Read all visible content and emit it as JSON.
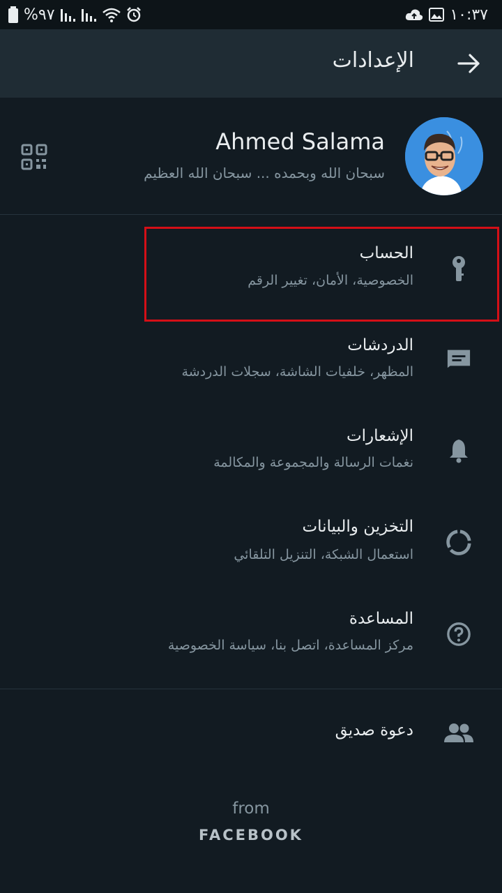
{
  "status_bar": {
    "battery": "%٩٧",
    "time": "١٠:٣٧"
  },
  "header": {
    "title": "الإعدادات"
  },
  "profile": {
    "name": "Ahmed Salama",
    "about": "سبحان الله وبحمده ... سبحان الله العظيم"
  },
  "settings": {
    "items": [
      {
        "label": "الحساب",
        "sub": "الخصوصية، الأمان، تغيير الرقم",
        "icon": "key-icon"
      },
      {
        "label": "الدردشات",
        "sub": "المظهر، خلفيات الشاشة، سجلات الدردشة",
        "icon": "chat-icon"
      },
      {
        "label": "الإشعارات",
        "sub": "نغمات الرسالة والمجموعة والمكالمة",
        "icon": "bell-icon"
      },
      {
        "label": "التخزين والبيانات",
        "sub": "استعمال الشبكة، التنزيل التلقائي",
        "icon": "data-usage-icon"
      },
      {
        "label": "المساعدة",
        "sub": "مركز المساعدة، اتصل بنا، سياسة الخصوصية",
        "icon": "help-icon"
      }
    ],
    "invite": {
      "label": "دعوة صديق",
      "icon": "people-icon"
    }
  },
  "footer": {
    "from": "from",
    "brand": "FACEBOOK"
  },
  "colors": {
    "background": "#121b22",
    "appbar": "#1f2c34",
    "icon": "#8696a0",
    "highlight": "#d40f17"
  }
}
